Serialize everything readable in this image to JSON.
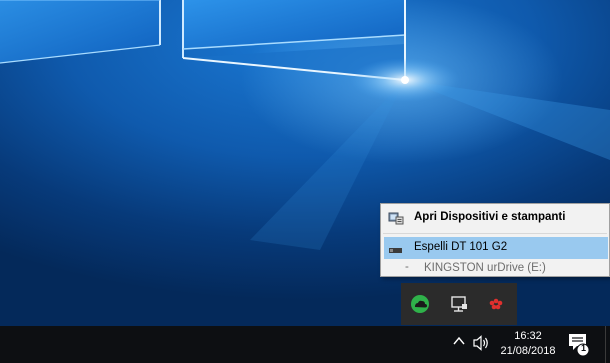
{
  "context_menu": {
    "header_label": "Apri Dispositivi e stampanti",
    "eject_label": "Espelli DT 101 G2",
    "drive_dash": "-",
    "drive_label": "KINGSTON urDrive (E:)"
  },
  "tray_overflow": {
    "icons": [
      "cloud-sync-icon",
      "network-monitor-icon",
      "paw-icon"
    ]
  },
  "taskbar": {
    "time": "16:32",
    "date": "21/08/2018",
    "notification_count": "1"
  },
  "colors": {
    "menu_highlight": "#99c9ef",
    "taskbar_bg": "#0d0f12",
    "desktop_blue": "#0f5aad"
  }
}
